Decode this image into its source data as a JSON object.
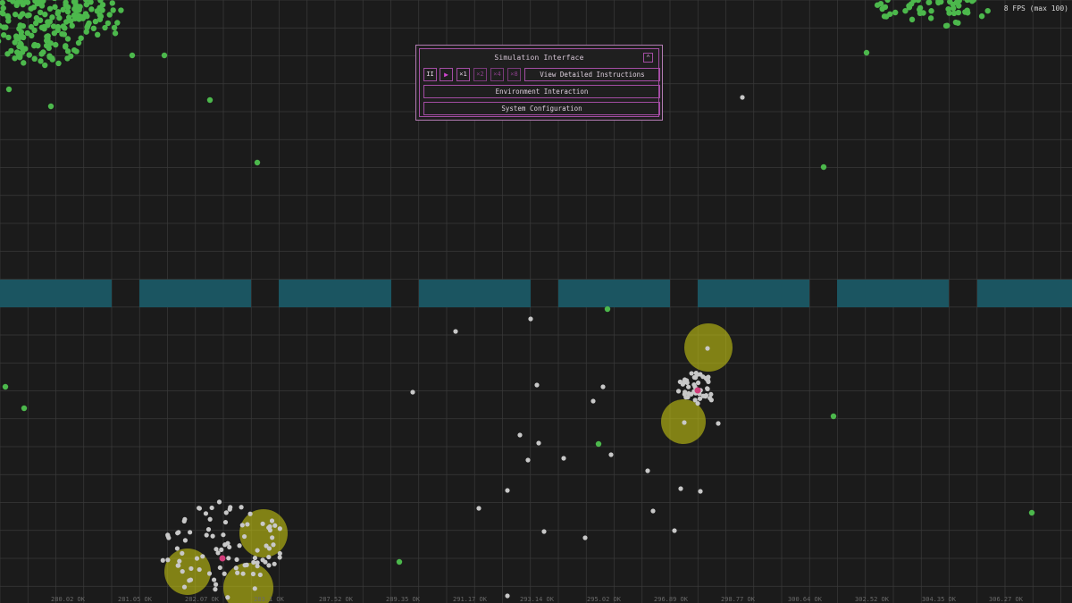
{
  "panel": {
    "title": "Simulation Interface",
    "close_label": "⌃",
    "pause_label": "II",
    "play_label": "▶",
    "speed_1": "×1",
    "speed_2": "×2",
    "speed_4": "×4",
    "speed_8": "×8",
    "instructions_label": "View Detailed Instructions",
    "environment_label": "Environment Interaction",
    "config_label": "System Configuration"
  },
  "fps": {
    "text": "8 FPS (max 100)"
  },
  "axis_bottom": {
    "labels": [
      "280.02 OK",
      "281.05 OK",
      "282.07 OK",
      "283.1 OK",
      "287.52 OK",
      "289.35 OK",
      "291.17 OK",
      "293.14 OK",
      "295.02 OK",
      "296.89 OK",
      "298.77 OK",
      "300.64 OK",
      "302.52 OK",
      "304.35 OK",
      "306.27 OK"
    ]
  },
  "colors": {
    "background": "#1b1b1b",
    "grid": "#3a3a3a",
    "water": "#1b5561",
    "food": "#4cb84c",
    "zone": "#c6c613",
    "creature": "#c8c8c8",
    "accent": "#a34da3"
  }
}
